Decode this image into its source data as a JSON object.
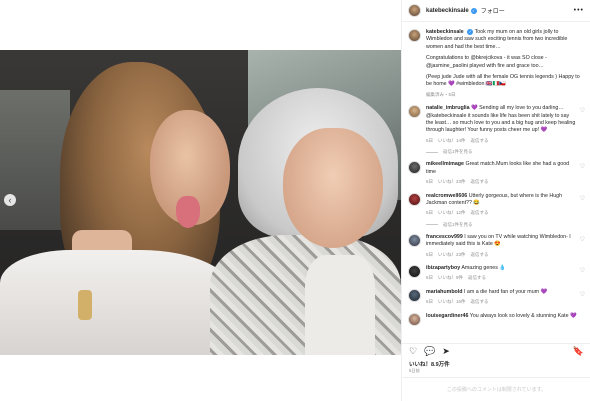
{
  "post": {
    "username": "katebeckinsale",
    "follow_label": "フォロー",
    "more_label": "•••",
    "caption_lines": [
      "Took my mum on an old girls jolly to Wimbledon and saw such exciting tennis from two incredible women and had the best time…",
      "Congratulations to @bkrejcikova - it was SO close - @jasmine_paolini played with fire and grace too…",
      "(Peep jude Jude with all the female OG tennis legends ) Happy to be home 💜 #wimbledon 🇬🇧🇮🇹🇨🇿"
    ],
    "caption_time": "編集済み・5日",
    "likes": "いいね！8.9万件",
    "date": "5日前",
    "add_comment_placeholder": "この投稿へのコメントは制限されています。"
  },
  "comments": [
    {
      "username": "natalie_imbruglia",
      "text": "💜 Sending all my love to you darling… @katebeckinsale it sounds like life has been shit lately to say the least… so much love to you and a big hug and keep healing through laughter! Your funny posts cheer me up! 💜",
      "time": "5日",
      "likes": "いいね！14件",
      "reply": "返信する",
      "view_replies": "返信1件を見る"
    },
    {
      "username": "mikeellmimage",
      "text": "Great match.Mum looks like she had a good time",
      "time": "5日",
      "likes": "いいね！23件",
      "reply": "返信する"
    },
    {
      "username": "realcromwell606",
      "text": "Utterly gorgeous, but where is the Hugh Jackman content?? 😂",
      "time": "5日",
      "likes": "いいね！12件",
      "reply": "返信する",
      "view_replies": "返信1件を見る"
    },
    {
      "username": "francescov999",
      "text": "I saw you on TV while watching Wimbledon- I immediately said this is Kate 😍",
      "time": "5日",
      "likes": "いいね！23件",
      "reply": "返信する"
    },
    {
      "username": "ibizapartyboy",
      "text": "Amazing genes 💧",
      "time": "5日",
      "likes": "いいね！9件",
      "reply": "返信する"
    },
    {
      "username": "mariahumbold",
      "text": "I am a die hard fan of your mum 💜",
      "time": "5日",
      "likes": "いいね！16件",
      "reply": "返信する"
    },
    {
      "username": "louisegardiner46",
      "text": "You always look so lovely & stunning Kate 💜",
      "time": "",
      "likes": "",
      "reply": ""
    }
  ],
  "icons": {
    "heart": "heart-icon",
    "comment": "comment-icon",
    "share": "share-icon",
    "save": "bookmark-icon"
  },
  "colors": {
    "verified": "#3897f0",
    "muted": "#8e8e8e",
    "text": "#262626"
  }
}
